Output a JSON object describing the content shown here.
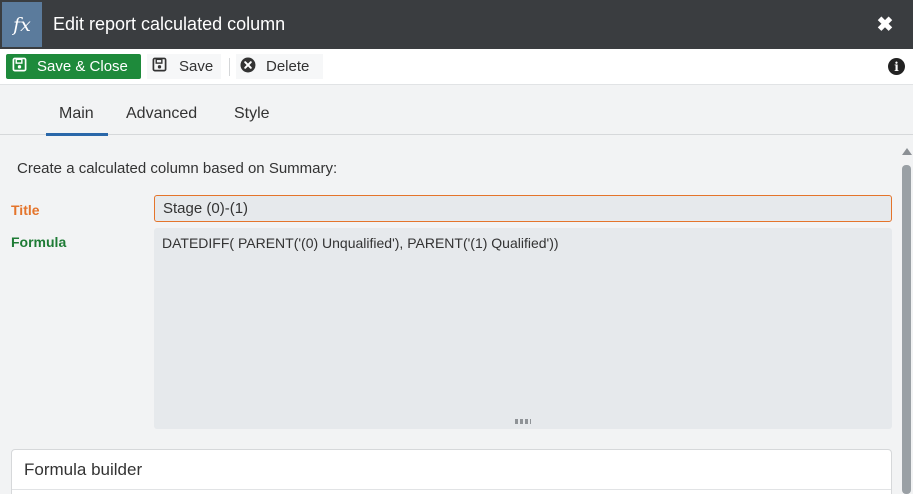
{
  "window": {
    "icon_label": "fx",
    "title": "Edit report calculated column",
    "close_glyph": "✖"
  },
  "toolbar": {
    "save_close_label": "Save & Close",
    "save_label": "Save",
    "delete_label": "Delete",
    "info_glyph": "i"
  },
  "tabs": [
    {
      "label": "Main",
      "active": true
    },
    {
      "label": "Advanced",
      "active": false
    },
    {
      "label": "Style",
      "active": false
    }
  ],
  "form": {
    "intro": "Create a calculated column based on Summary:",
    "title_label": "Title",
    "title_value": "Stage (0)-(1)",
    "formula_label": "Formula",
    "formula_value": "DATEDIFF( PARENT('(0) Unqualified'), PARENT('(1) Qualified'))"
  },
  "formula_builder": {
    "title": "Formula builder"
  },
  "colors": {
    "titlebar": "#3a3d40",
    "fx_icon_bg": "#5b7b9c",
    "primary_green": "#1e8a3b",
    "title_label_orange": "#e4742b",
    "formula_label_green": "#1e7b35",
    "tab_accent": "#2a67a9"
  }
}
